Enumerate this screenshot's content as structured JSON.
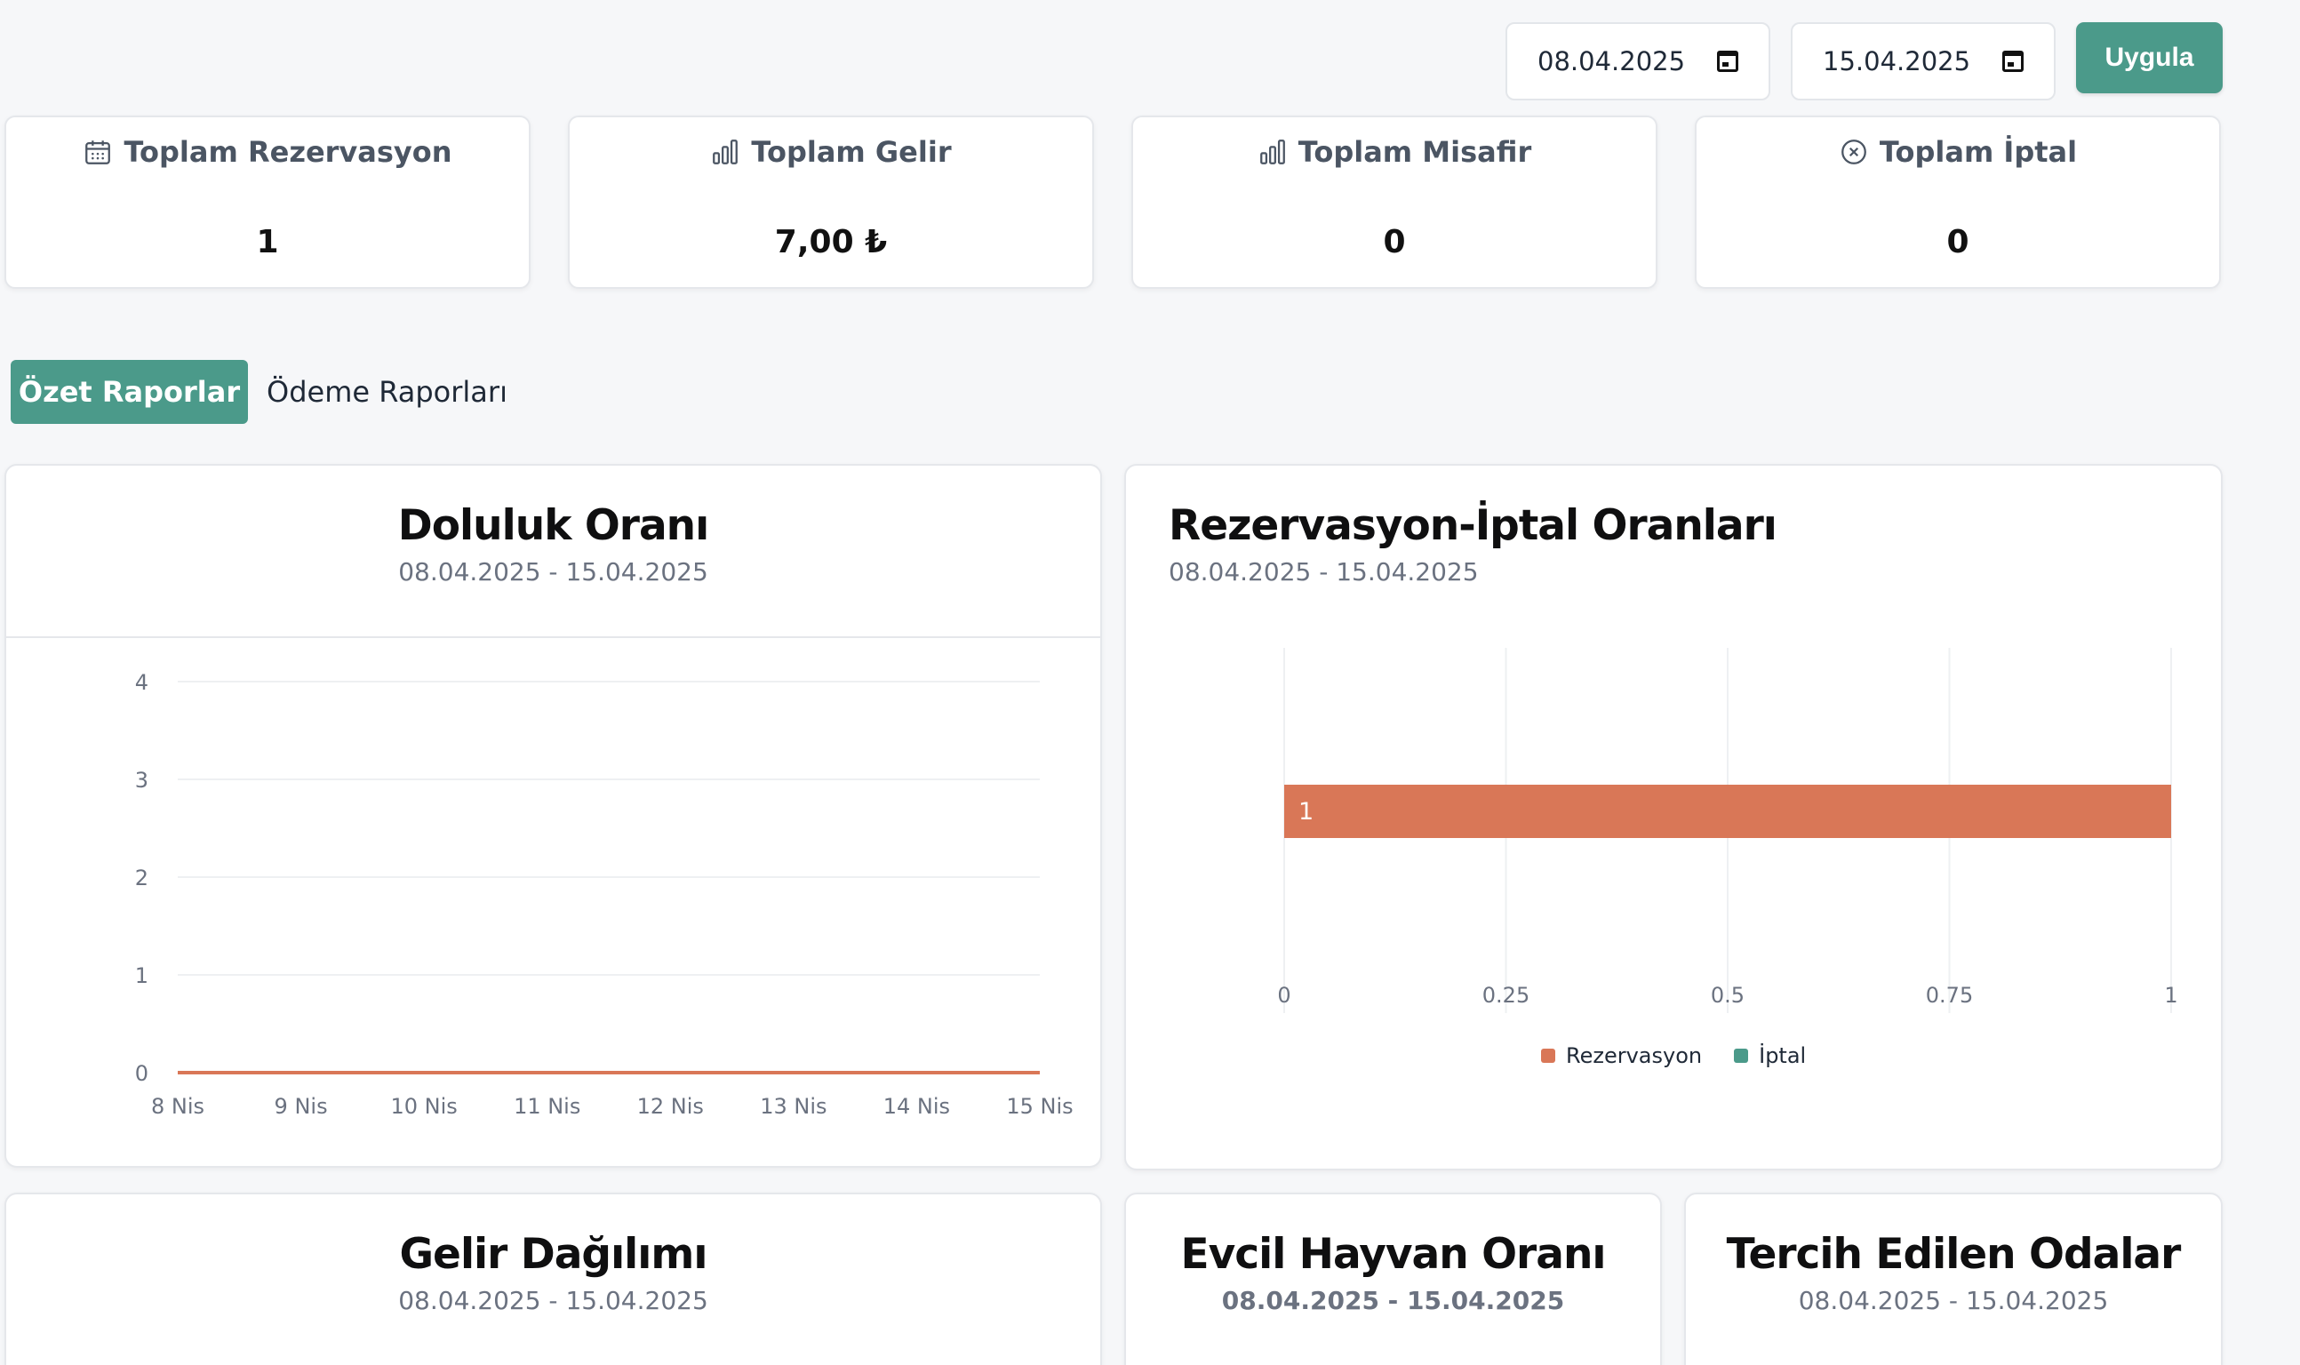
{
  "filters": {
    "start_date": "08.04.2025",
    "end_date": "15.04.2025",
    "apply_label": "Uygula"
  },
  "stats": [
    {
      "icon": "calendar-icon",
      "label": "Toplam Rezervasyon",
      "value": "1"
    },
    {
      "icon": "bar-chart-icon",
      "label": "Toplam Gelir",
      "value": "7,00 ₺"
    },
    {
      "icon": "bar-chart-icon",
      "label": "Toplam Misafir",
      "value": "0"
    },
    {
      "icon": "circle-x-icon",
      "label": "Toplam İptal",
      "value": "0"
    }
  ],
  "tabs": [
    {
      "label": "Özet Raporlar",
      "active": true
    },
    {
      "label": "Ödeme Raporları",
      "active": false
    }
  ],
  "colors": {
    "accent": "#4b9a8a",
    "reservation": "#d97757",
    "cancel": "#4b9a8a"
  },
  "occupancy": {
    "title": "Doluluk Oranı",
    "date_range": "08.04.2025 - 15.04.2025"
  },
  "reservation_cancel": {
    "title": "Rezervasyon-İptal Oranları",
    "date_range": "08.04.2025 - 15.04.2025",
    "legend": [
      "Rezervasyon",
      "İptal"
    ]
  },
  "revenue": {
    "title": "Gelir Dağılımı",
    "date_range": "08.04.2025 - 15.04.2025"
  },
  "pet": {
    "title": "Evcil Hayvan Oranı",
    "date_range": "08.04.2025 - 15.04.2025"
  },
  "rooms": {
    "title": "Tercih Edilen Odalar",
    "date_range": "08.04.2025 - 15.04.2025"
  },
  "chart_data": [
    {
      "type": "line",
      "x": [
        "8 Nis",
        "9 Nis",
        "10 Nis",
        "11 Nis",
        "12 Nis",
        "13 Nis",
        "14 Nis",
        "15 Nis"
      ],
      "series": [
        {
          "values": [
            0,
            0,
            0,
            0,
            0,
            0,
            0,
            0
          ]
        }
      ],
      "yticks": [
        0,
        1,
        2,
        3,
        4
      ],
      "ylim": [
        0,
        4
      ],
      "grid": true
    },
    {
      "type": "bar",
      "orientation": "horizontal",
      "series": [
        {
          "name": "Rezervasyon",
          "values": [
            1
          ],
          "labels": [
            "1"
          ]
        },
        {
          "name": "İptal",
          "values": [
            0
          ]
        }
      ],
      "xticks": [
        "0",
        "0.25",
        "0.5",
        "0.75",
        "1"
      ],
      "xlim": [
        0,
        1
      ],
      "grid": true,
      "legend": "bottom-center"
    }
  ]
}
